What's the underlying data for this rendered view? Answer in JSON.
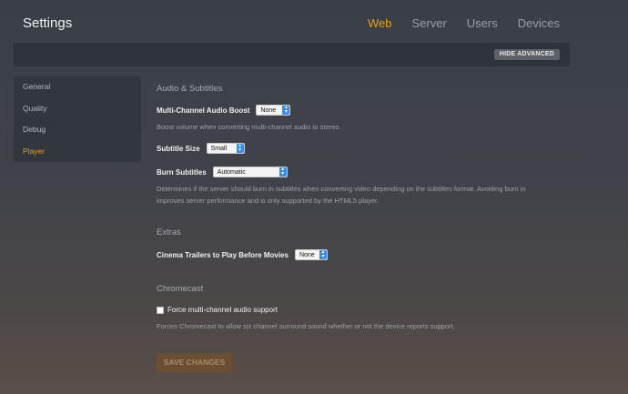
{
  "header": {
    "title": "Settings",
    "tabs": [
      {
        "label": "Web",
        "active": true
      },
      {
        "label": "Server",
        "active": false
      },
      {
        "label": "Users",
        "active": false
      },
      {
        "label": "Devices",
        "active": false
      }
    ]
  },
  "toolbar": {
    "hide_advanced_label": "HIDE ADVANCED"
  },
  "sidebar": {
    "items": [
      {
        "label": "General"
      },
      {
        "label": "Quality"
      },
      {
        "label": "Debug"
      },
      {
        "label": "Player",
        "active": true
      }
    ]
  },
  "audio": {
    "heading": "Audio & Subtitles",
    "boost_label": "Multi-Channel Audio Boost",
    "boost_value": "None",
    "boost_help": "Boost volume when converting multi-channel audio to stereo.",
    "subtitle_size_label": "Subtitle Size",
    "subtitle_size_value": "Small",
    "burn_label": "Burn Subtitles",
    "burn_value": "Automatic",
    "burn_help_1": "Determines if the server should burn in subtitles when converting video depending on the subtitles format. Avoiding burn in",
    "burn_help_2": "improves server performance and is only supported by the HTML5 player."
  },
  "extras": {
    "heading": "Extras",
    "trailers_label": "Cinema Trailers to Play Before Movies",
    "trailers_value": "None"
  },
  "chromecast": {
    "heading": "Chromecast",
    "force_label": "Force multi-channel audio support",
    "force_checked": false,
    "force_help": "Forces Chromecast to allow six channel surround sound whether or not the device reports support."
  },
  "footer": {
    "save_label": "SAVE CHANGES"
  },
  "colors": {
    "accent": "#e5a00d",
    "select_arrow": "#3a8be8",
    "save_button": "#6a4f33"
  }
}
